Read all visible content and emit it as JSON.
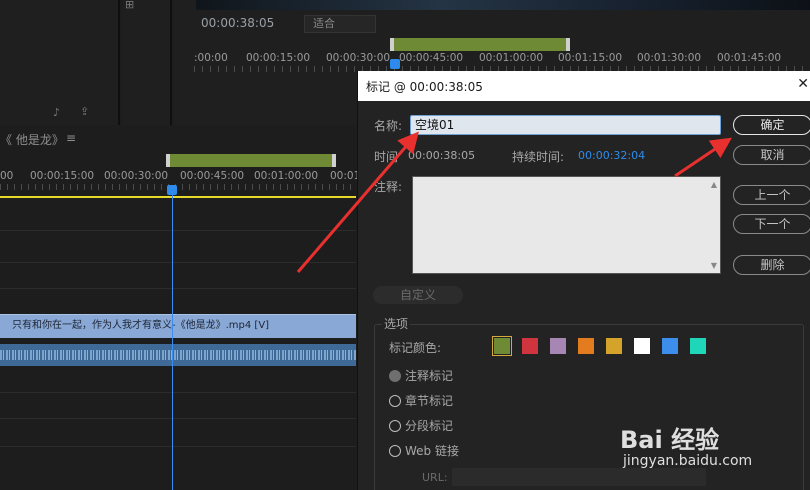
{
  "source_monitor": {
    "timecode": "00:00:38:05",
    "fit_label": "适合",
    "ruler_ticks": [
      ":00:00",
      "00:00:15:00",
      "00:00:30:00",
      "00:00:45:00",
      "00:01:00:00",
      "00:01:15:00",
      "00:01:30:00",
      "00:01:45:00"
    ]
  },
  "timeline": {
    "sequence_tab": "《 他是龙》",
    "menu_glyph": "≡",
    "ruler_ticks": [
      "00",
      "00:00:15:00",
      "00:00:30:00",
      "00:00:45:00",
      "00:01:00:00",
      "00:01"
    ],
    "video_clip_label": "只有和你在一起，作为人我才有意义-《他是龙》.mp4 [V]"
  },
  "dialog": {
    "title": "标记 @ 00:00:38:05",
    "close_glyph": "✕",
    "name_label": "名称:",
    "name_value": "空境01",
    "in_label": "时间",
    "in_value": "00:00:38:05",
    "duration_label": "持续时间:",
    "duration_value": "00:00:32:04",
    "comment_label": "注释:",
    "buttons": {
      "ok": "确定",
      "cancel": "取消",
      "prev": "上一个",
      "next": "下一个",
      "delete": "删除"
    },
    "custom_label": "自定义",
    "options_label": "选项",
    "color_label": "标记颜色:",
    "colors": [
      "#6e8a35",
      "#d0343f",
      "#a886b4",
      "#e27c1e",
      "#d4a32a",
      "#ffffff",
      "#3d8ded",
      "#20d6b8"
    ],
    "marker_types": [
      "注释标记",
      "章节标记",
      "分段标记",
      "Web 链接"
    ],
    "url_label": "URL:"
  },
  "watermark": {
    "brand": "Bai 经验",
    "url": "jingyan.baidu.com"
  }
}
